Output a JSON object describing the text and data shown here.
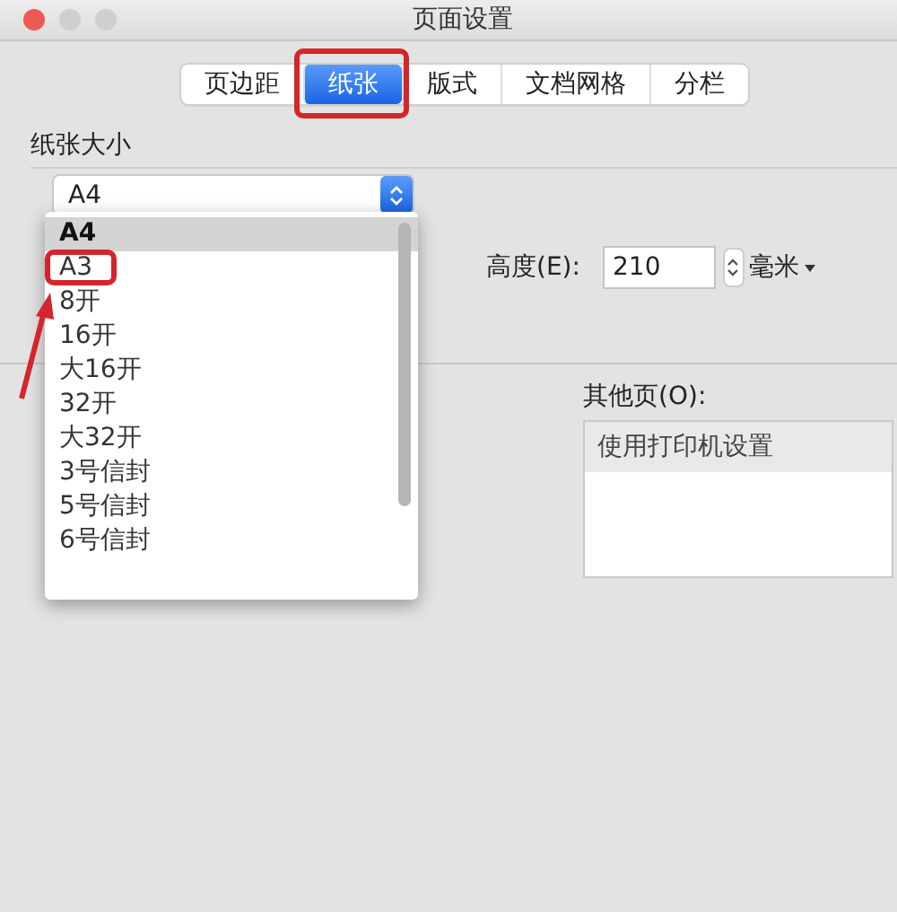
{
  "window": {
    "title": "页面设置"
  },
  "tabs": [
    {
      "label": "页边距",
      "selected": false
    },
    {
      "label": "纸张",
      "selected": true
    },
    {
      "label": "版式",
      "selected": false
    },
    {
      "label": "文档网格",
      "selected": false
    },
    {
      "label": "分栏",
      "selected": false
    }
  ],
  "paper_size": {
    "label": "纸张大小",
    "value": "A4",
    "menu": [
      {
        "label": "A4",
        "selected": true
      },
      {
        "label": "A3",
        "selected": false
      },
      {
        "label": "8开",
        "selected": false
      },
      {
        "label": "16开",
        "selected": false
      },
      {
        "label": "大16开",
        "selected": false
      },
      {
        "label": "32开",
        "selected": false
      },
      {
        "label": "大32开",
        "selected": false
      },
      {
        "label": "3号信封",
        "selected": false
      },
      {
        "label": "5号信封",
        "selected": false
      },
      {
        "label": "6号信封",
        "selected": false
      }
    ]
  },
  "height": {
    "label": "高度(E):",
    "value": "210",
    "unit": "毫米"
  },
  "other_pages": {
    "label": "其他页(O):",
    "items": [
      {
        "label": "使用打印机设置",
        "selected": true
      }
    ]
  }
}
